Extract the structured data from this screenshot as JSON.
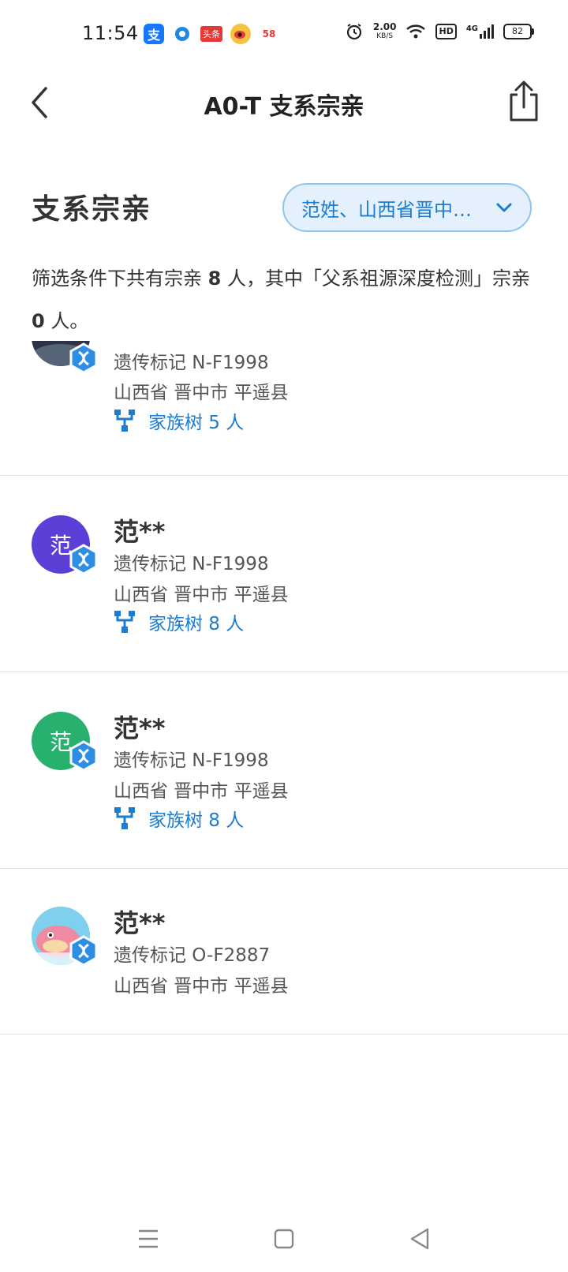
{
  "status_bar": {
    "time": "11:54",
    "app_icons": [
      "alipay-icon",
      "circle-app-icon",
      "toutiao-icon",
      "weibo-icon",
      "58-icon"
    ],
    "toutiao_text": "头条",
    "app58_text": "58",
    "net_speed": "2.00",
    "net_unit": "KB/S",
    "hd": "HD",
    "signal": "4G",
    "battery": "82"
  },
  "nav": {
    "title": "A0-T 支系宗亲"
  },
  "header": {
    "section_title": "支系宗亲",
    "filter_label": "范姓、山西省晋中…"
  },
  "summary": {
    "prefix": "筛选条件下共有宗亲 ",
    "total": "8",
    "middle": " 人，其中「父系祖源深度检测」宗亲 ",
    "deep": "0",
    "suffix": " 人。"
  },
  "relatives": [
    {
      "name": "",
      "marker": "遗传标记 N-F1998",
      "location": "山西省 晋中市 平遥县",
      "tree": "家族树 5 人",
      "avatar_type": "photo",
      "avatar_color": "#3a3f52"
    },
    {
      "name": "范**",
      "avatar_text": "范",
      "marker": "遗传标记 N-F1998",
      "location": "山西省 晋中市 平遥县",
      "tree": "家族树 8 人",
      "avatar_type": "text",
      "avatar_color": "#5b3fd6"
    },
    {
      "name": "范**",
      "avatar_text": "范",
      "marker": "遗传标记 N-F1998",
      "location": "山西省 晋中市 平遥县",
      "tree": "家族树 8 人",
      "avatar_type": "text",
      "avatar_color": "#27b06e"
    },
    {
      "name": "范**",
      "marker": "遗传标记 O-F2887",
      "location": "山西省 晋中市 平遥县",
      "tree": "",
      "avatar_type": "cartoon",
      "avatar_color": "#7fd0ec"
    }
  ],
  "colors": {
    "accent": "#1b7cd0",
    "filter_bg": "#e4f1fc",
    "filter_border": "#8ec4ec",
    "badge": "#2d8ee4"
  }
}
